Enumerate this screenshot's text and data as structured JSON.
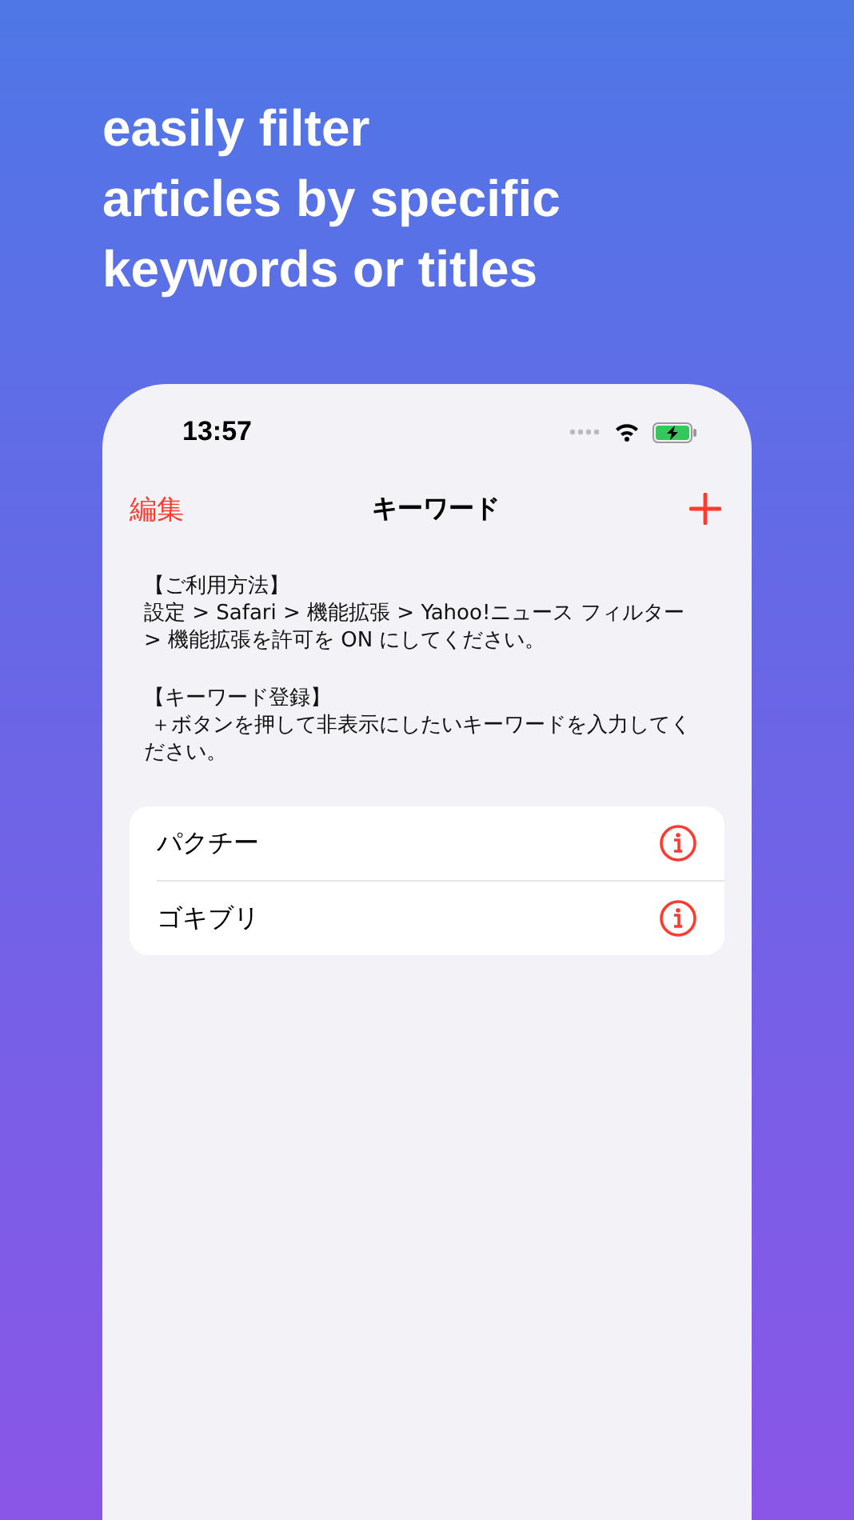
{
  "headline": [
    "easily filter",
    "articles by specific",
    "keywords or titles"
  ],
  "status_bar": {
    "time": "13:57"
  },
  "nav": {
    "left": "編集",
    "title": "キーワード"
  },
  "instructions": [
    {
      "heading": "【ご利用方法】",
      "lines": [
        "設定 > Safari > 機能拡張 > Yahoo!ニュース フィルター",
        "> 機能拡張を許可を ON にしてください。"
      ]
    },
    {
      "heading": "【キーワード登録】",
      "lines": [
        " ＋ボタンを押して非表示にしたいキーワードを入力してください。"
      ]
    }
  ],
  "keywords": [
    {
      "label": "パクチー"
    },
    {
      "label": "ゴキブリ"
    }
  ]
}
